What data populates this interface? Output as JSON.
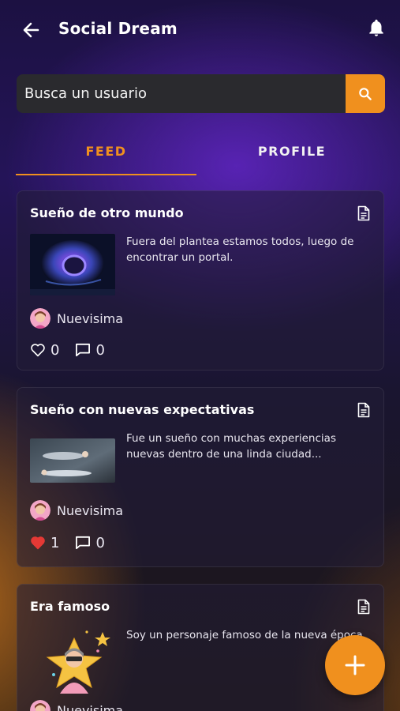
{
  "header": {
    "title": "Social Dream",
    "back_icon": "arrow-left-icon",
    "notification_icon": "bell-icon"
  },
  "search": {
    "placeholder": "Busca un usuario",
    "button_icon": "search-icon"
  },
  "tabs": [
    {
      "label": "FEED",
      "active": true
    },
    {
      "label": "PROFILE",
      "active": false
    }
  ],
  "posts": [
    {
      "title": "Sueño de otro mundo",
      "text": "Fuera del plantea estamos todos, luego de encontrar un portal.",
      "author": "Nuevisima",
      "likes": "0",
      "liked": false,
      "comments": "0"
    },
    {
      "title": "Sueño con nuevas expectativas",
      "text": "Fue un sueño con muchas experiencias nuevas dentro de una linda ciudad...",
      "author": "Nuevisima",
      "likes": "1",
      "liked": true,
      "comments": "0"
    },
    {
      "title": "Era famoso",
      "text": "Soy un personaje famoso de la nueva época",
      "author": "Nuevisima"
    }
  ],
  "fab": {
    "icon": "plus-icon"
  },
  "colors": {
    "accent": "#f0901e",
    "like_active": "#e53935"
  }
}
